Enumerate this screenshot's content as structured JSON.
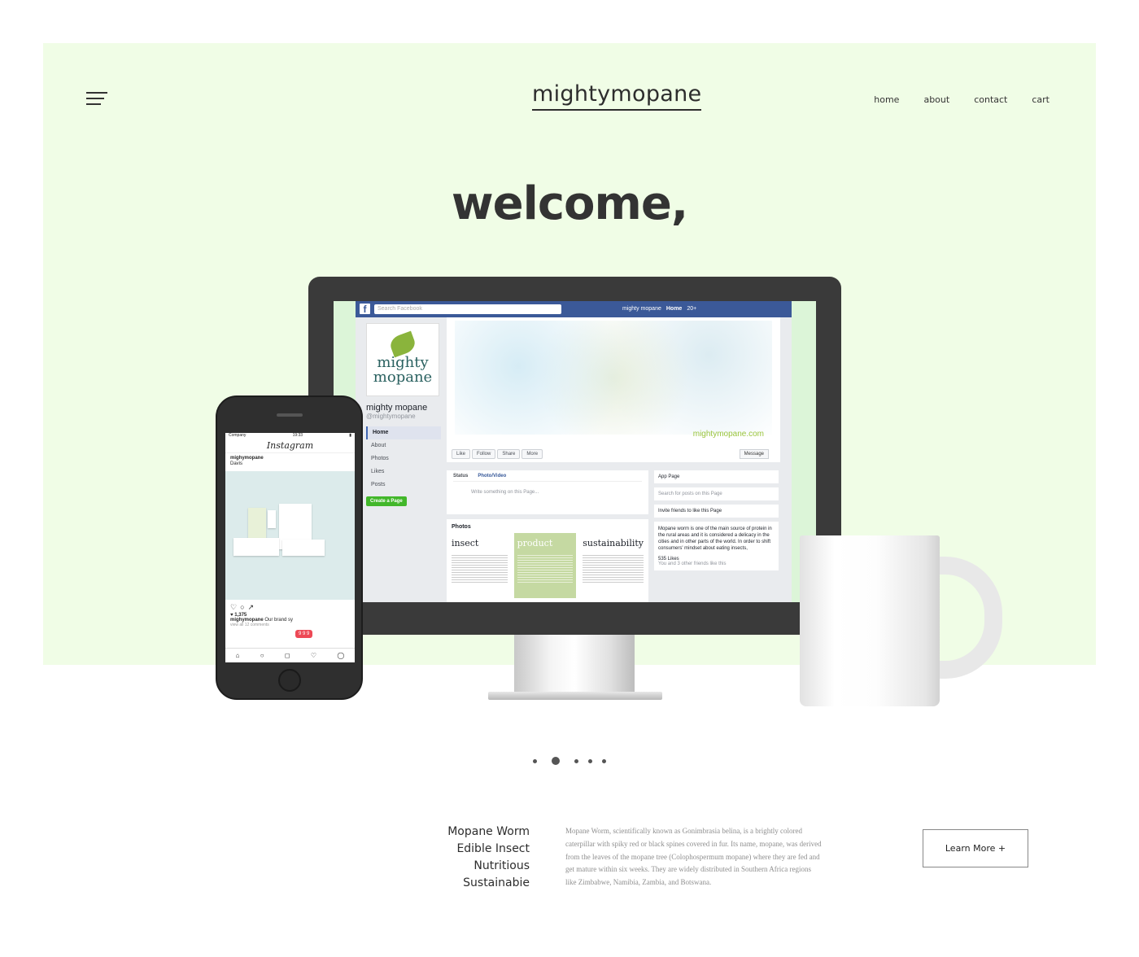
{
  "header": {
    "logo": "mightymopane",
    "nav": [
      "home",
      "about",
      "contact",
      "cart"
    ]
  },
  "hero": {
    "headline": "welcome,"
  },
  "facebook": {
    "search_placeholder": "Search Facebook",
    "user_name": "mighty mopane",
    "home_label": "Home",
    "home_count": "20+",
    "page_brand_line1": "mighty",
    "page_brand_line2": "mopane",
    "page_name": "mighty mopane",
    "page_handle": "@mightymopane",
    "menu": [
      "Home",
      "About",
      "Photos",
      "Likes",
      "Posts"
    ],
    "create_page": "Create a Page",
    "cover_url": "mightymopane.com",
    "cover_buttons": [
      "Like",
      "Follow",
      "Share",
      "More"
    ],
    "message_button": "Message",
    "status_label": "Status",
    "photo_video_label": "Photo/Video",
    "composer_placeholder": "Write something on this Page...",
    "photos_title": "Photos",
    "photo_columns": [
      "insect",
      "product",
      "sustainability"
    ],
    "app_page": "App Page",
    "search_posts": "Search for posts on this Page",
    "invite_friends": "Invite friends to like this Page",
    "about_text": "Mopane worm is one of the main source of protein in the rural areas and it is considered a delicacy in the cities and in other parts of the world. In order to shift consumers' mindset about eating insects,",
    "likes_count": "535 Likes",
    "likes_sub": "You and 3 other friends like this"
  },
  "instagram": {
    "status_carrier": "Company",
    "status_time": "19:33",
    "title": "Instagram",
    "post_user": "mighymopane",
    "post_location": "Davis",
    "likes": "1,375",
    "caption_user": "mighymopane",
    "caption_text": "Our brand sy",
    "comments_link": "view all 12 comments",
    "notification": "9 9 9"
  },
  "slider": {
    "dot_count": 5,
    "active_index": 1
  },
  "info": {
    "tags": [
      "Mopane Worm",
      "Edible Insect",
      "Nutritious",
      "Sustainabie"
    ],
    "description": "Mopane Worm, scientifically known as Gonimbrasia belina, is a brightly colored caterpillar with spiky red or black spines covered in fur.  Its name, mopane, was derived from the leaves of the mopane tree (Colophospermum mopane) where they are fed and get mature within six weeks. They are widely distributed in Southern Africa regions like Zimbabwe, Namibia, Zambia, and Botswana.",
    "cta": "Learn More +"
  },
  "colors": {
    "hero_bg": "#f0fde6",
    "fb_blue": "#3b5998",
    "brand_green": "#9bc53d",
    "text_dark": "#2d2d2d"
  }
}
